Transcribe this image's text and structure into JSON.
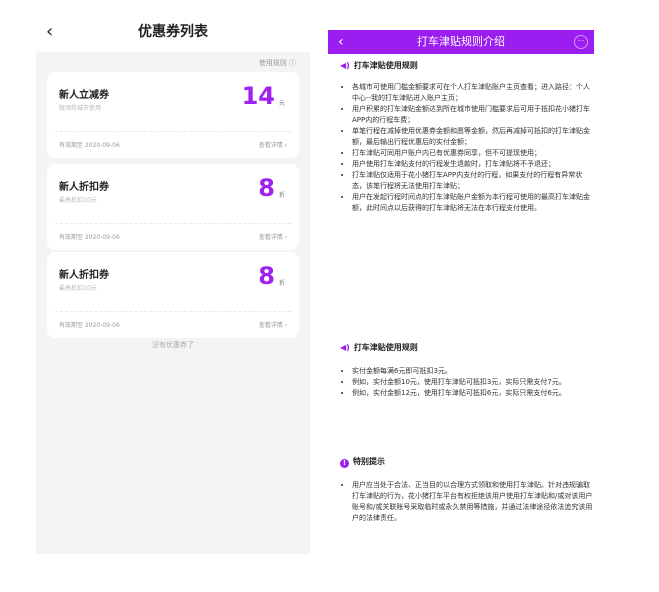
{
  "left": {
    "back_icon": "chevron-left-icon",
    "title": "优惠券列表",
    "rules_link": "使用规则 ⓘ",
    "coupons": [
      {
        "name": "新人立减券",
        "desc": "限领券城市使用",
        "amount": "14",
        "unit": "元",
        "expiry": "有效期至 2020-09-06",
        "detail": "查看详情 ›"
      },
      {
        "name": "新人折扣券",
        "desc": "最高抵扣10元",
        "amount": "8",
        "unit": "折",
        "expiry": "有效期至 2020-09-06",
        "detail": "查看详情 ›"
      },
      {
        "name": "新人折扣券",
        "desc": "最高抵扣10元",
        "amount": "8",
        "unit": "折",
        "expiry": "有效期至 2020-09-06",
        "detail": "查看详情 ›"
      }
    ],
    "no_more": "没有优惠券了"
  },
  "right": {
    "header": {
      "back": "‹",
      "title": "打车津贴规则介绍",
      "more": "···",
      "bg_color": "#9b1df0"
    },
    "sections": [
      {
        "icon": "speaker-icon",
        "title": "打车津贴使用规则",
        "items": [
          "各城市可使用门槛金额要求可在个人打车津贴账户主页查看；进入路径：个人中心--我的打车津贴进入账户主页；",
          "用户积累的打车津贴金额达到所在城市使用门槛要求后可用于抵扣花小猪打车APP内的行程车费；",
          "单笔行程在减掉使用优惠券金额和愿等金额，然后再减掉可抵扣的打车津贴金额，最后输出行程优惠后的实付金额；",
          "打车津贴可同用户账户内已有优惠券同享，但不可提现使用；",
          "用户使用打车津贴支付的行程发生退款时，打车津贴将不予退还；",
          "打车津贴仅适用于花小猪打车APP内支付的行程，如果支付的行程有异常状态，该笔行程将无法使用打车津贴；",
          "用户在发起行程时间点的打车津贴账户金额为本行程可使用的最高打车津贴金额，此时间点以后获得的打车津贴将无法在本行程支付使用。"
        ]
      },
      {
        "icon": "speaker-icon",
        "title": "打车津贴使用规则",
        "items": [
          "实付金额每满6元即可抵扣3元。",
          "例如，实付金额10元，使用打车津贴可抵扣3元，实际只需支付7元。",
          "例如，实付金额12元，使用打车津贴可抵扣6元，实际只需支付6元。"
        ]
      },
      {
        "icon": "info-circle-icon",
        "icon_glyph": "!",
        "title": "特别提示",
        "items": [
          "用户应当处于合法、正当目的以合理方式领取和使用打车津贴。针对违规骗取打车津贴的行为，花小猪打车平台有权拒绝该用户使用打车津贴和/或对该用户账号和/或关联账号采取临时或永久禁用等措施，并通过法律途径依法追究该用户的法律责任。"
        ]
      }
    ]
  }
}
